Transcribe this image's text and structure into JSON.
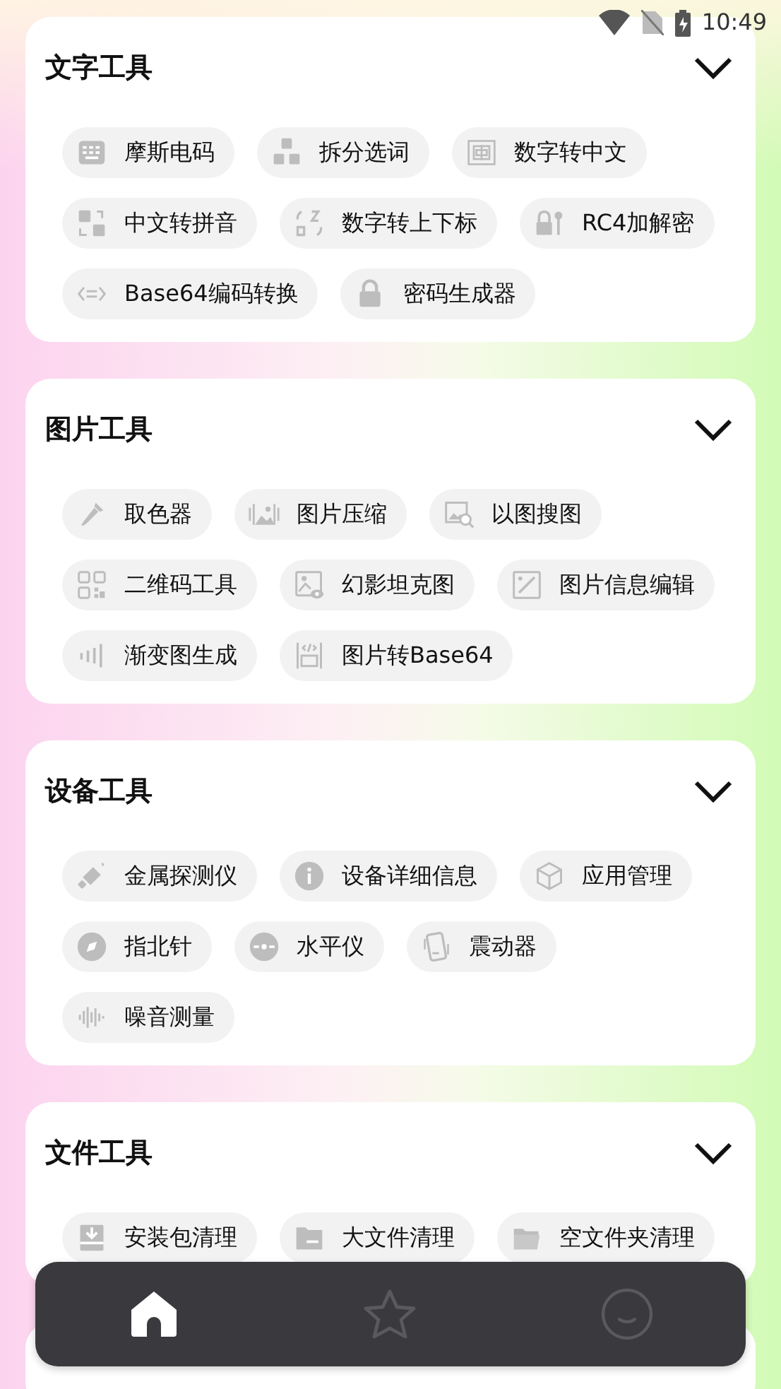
{
  "status_bar": {
    "time": "10:49"
  },
  "sections": [
    {
      "title": "文字工具",
      "expanded": true,
      "tools": [
        {
          "label": "摩斯电码"
        },
        {
          "label": "拆分选词"
        },
        {
          "label": "数字转中文"
        },
        {
          "label": "中文转拼音"
        },
        {
          "label": "数字转上下标"
        },
        {
          "label": "RC4加解密"
        },
        {
          "label": "Base64编码转换"
        },
        {
          "label": "密码生成器"
        }
      ]
    },
    {
      "title": "图片工具",
      "expanded": true,
      "tools": [
        {
          "label": "取色器"
        },
        {
          "label": "图片压缩"
        },
        {
          "label": "以图搜图"
        },
        {
          "label": "二维码工具"
        },
        {
          "label": "幻影坦克图"
        },
        {
          "label": "图片信息编辑"
        },
        {
          "label": "渐变图生成"
        },
        {
          "label": "图片转Base64"
        }
      ]
    },
    {
      "title": "设备工具",
      "expanded": true,
      "tools": [
        {
          "label": "金属探测仪"
        },
        {
          "label": "设备详细信息"
        },
        {
          "label": "应用管理"
        },
        {
          "label": "指北针"
        },
        {
          "label": "水平仪"
        },
        {
          "label": "震动器"
        },
        {
          "label": "噪音测量"
        }
      ]
    },
    {
      "title": "文件工具",
      "expanded": true,
      "tools": [
        {
          "label": "安装包清理"
        },
        {
          "label": "大文件清理"
        },
        {
          "label": "空文件夹清理"
        }
      ]
    }
  ],
  "nav": [
    {
      "kind": "home",
      "selected": true
    },
    {
      "kind": "star",
      "selected": false
    },
    {
      "kind": "face",
      "selected": false
    }
  ]
}
